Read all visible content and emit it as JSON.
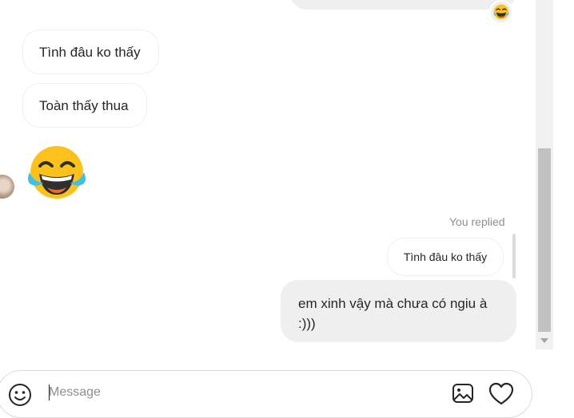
{
  "thread": {
    "received": [
      {
        "text": "Tình đâu ko thấy"
      },
      {
        "text": "Toàn thấy thua"
      }
    ],
    "big_emoji": "laughing-tears-emoji",
    "reply": {
      "label": "You replied",
      "quoted": "Tình đâu ko thấy",
      "message": "em xinh vậy mà chưa có ngiu à :)))"
    },
    "reaction_icon": "laughing-tears-emoji"
  },
  "composer": {
    "placeholder": "Message",
    "icons": [
      "emoji-icon",
      "image-icon",
      "heart-icon"
    ]
  }
}
